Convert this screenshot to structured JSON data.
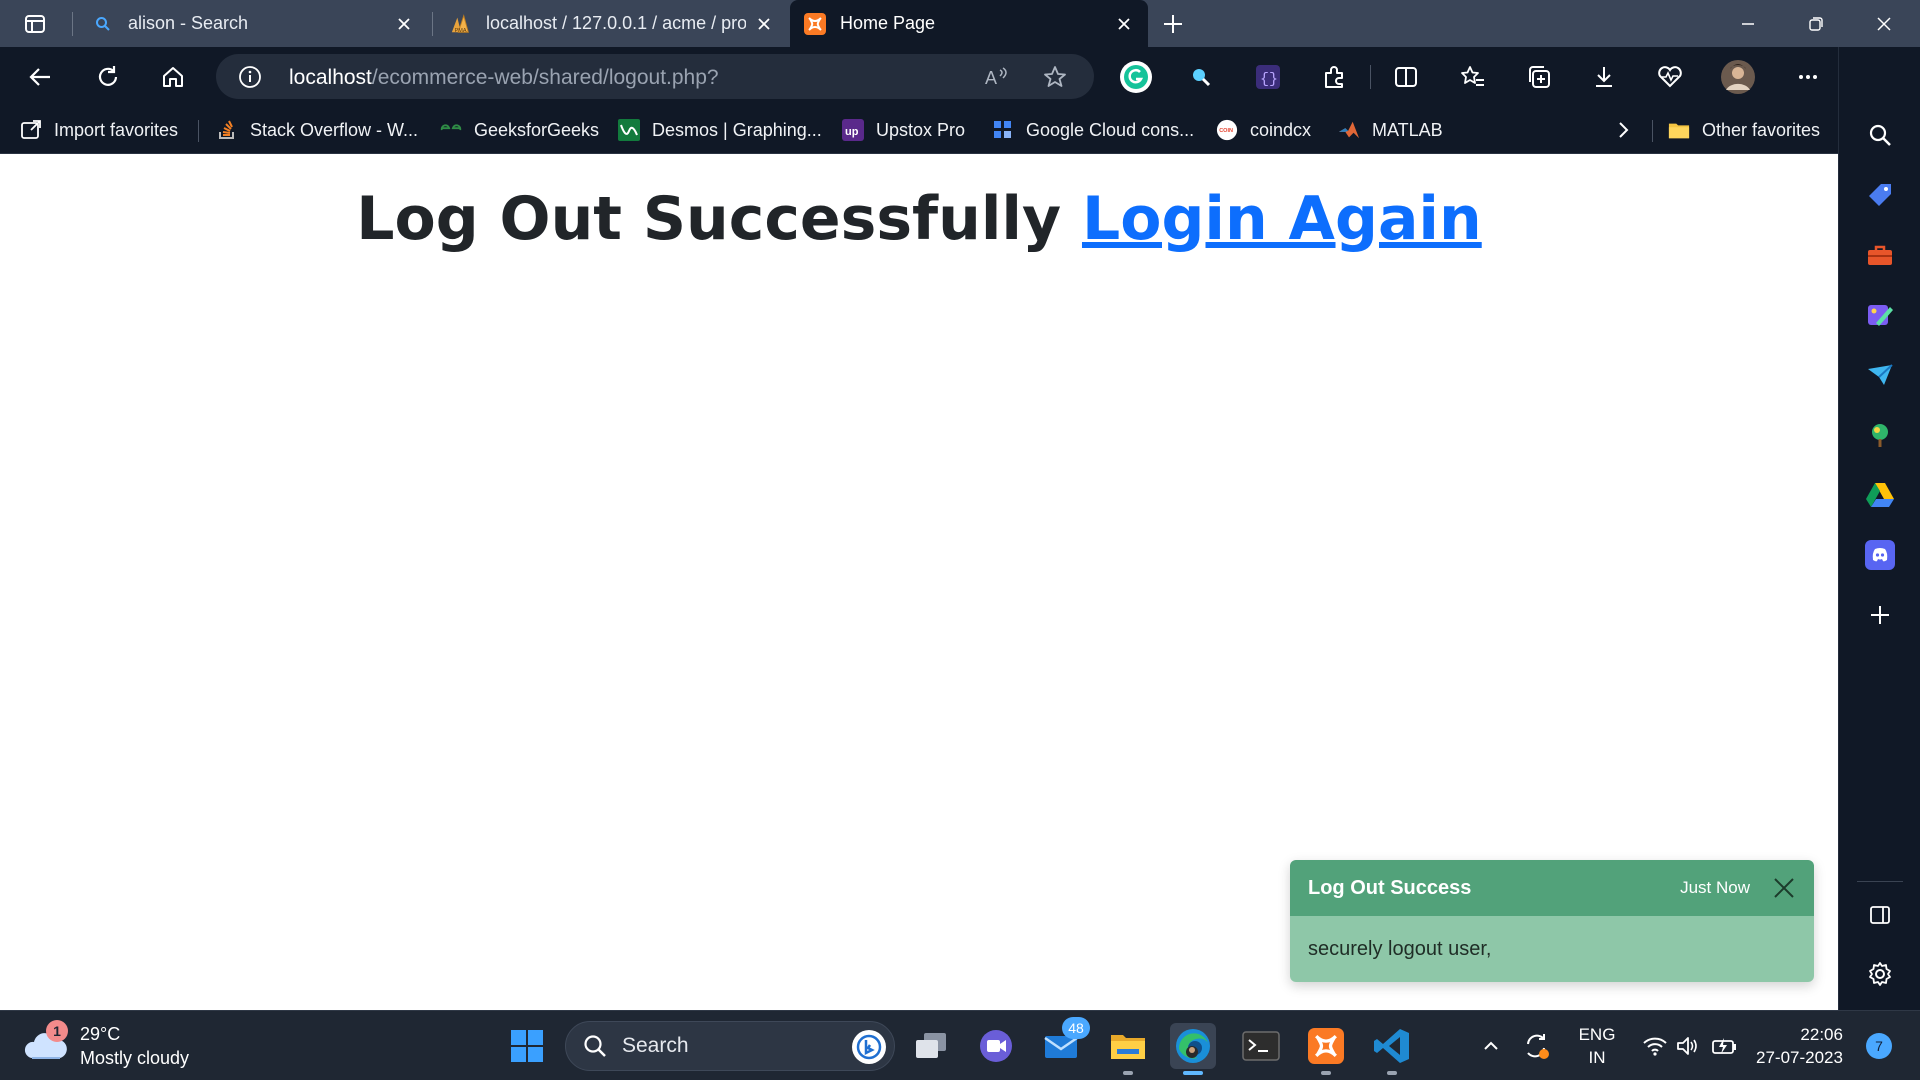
{
  "browser": {
    "tabs": [
      {
        "title": "alison - Search",
        "icon": "search-icon"
      },
      {
        "title": "localhost / 127.0.0.1 / acme / pro",
        "icon": "phpmyadmin-icon"
      },
      {
        "title": "Home Page",
        "icon": "xampp-icon"
      }
    ],
    "address": {
      "host": "localhost",
      "path": "/ecommerce-web/shared/logout.php?"
    },
    "favorites": [
      {
        "label": "Import favorites",
        "icon": "import-icon"
      },
      {
        "label": "Stack Overflow - W...",
        "icon": "stackoverflow-icon"
      },
      {
        "label": "GeeksforGeeks",
        "icon": "geeksforgeeks-icon"
      },
      {
        "label": "Desmos | Graphing...",
        "icon": "desmos-icon"
      },
      {
        "label": "Upstox Pro",
        "icon": "upstox-icon"
      },
      {
        "label": "Google Cloud cons...",
        "icon": "google-cloud-icon"
      },
      {
        "label": "coindcx",
        "icon": "coindcx-icon"
      },
      {
        "label": "MATLAB",
        "icon": "matlab-icon"
      }
    ],
    "other_favorites": "Other favorites",
    "colors": {
      "chrome_dark": "#101826",
      "tabbar": "#3a4558",
      "link": "#0d6efd"
    }
  },
  "page": {
    "heading": "Log Out Successfully",
    "link": "Login Again"
  },
  "toast": {
    "title": "Log Out Success",
    "time": "Just Now",
    "message": "securely logout user,",
    "colors": {
      "header": "#52a27a",
      "body": "#8ec7a8"
    }
  },
  "taskbar": {
    "weather": {
      "temp": "29°C",
      "desc": "Mostly cloudy",
      "badge": "1"
    },
    "search_label": "Search",
    "mail_badge": "48",
    "language": {
      "line1": "ENG",
      "line2": "IN"
    },
    "time": "22:06",
    "date": "27-07-2023",
    "notifications": "7"
  }
}
